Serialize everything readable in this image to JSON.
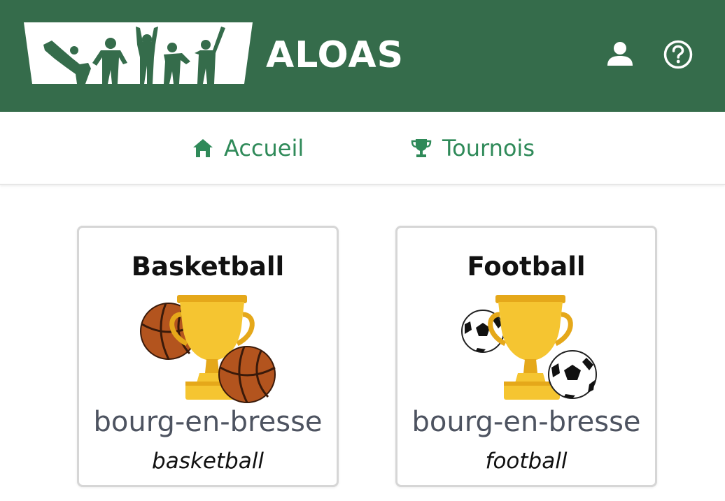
{
  "header": {
    "brand": "ALOAS",
    "icons": [
      "logo-silhouettes",
      "user-icon",
      "help-icon"
    ]
  },
  "nav": {
    "items": [
      {
        "label": "Accueil",
        "icon": "home-icon"
      },
      {
        "label": "Tournois",
        "icon": "trophy-icon"
      }
    ]
  },
  "colors": {
    "header_bg": "#356c4b",
    "nav_text": "#2f8a59",
    "card_border": "#d6d6d6"
  },
  "tournaments": [
    {
      "title": "Basketball",
      "city": "bourg-en-bresse",
      "sport": "basketball",
      "image": "trophy-basketball"
    },
    {
      "title": "Football",
      "city": "bourg-en-bresse",
      "sport": "football",
      "image": "trophy-football"
    }
  ]
}
